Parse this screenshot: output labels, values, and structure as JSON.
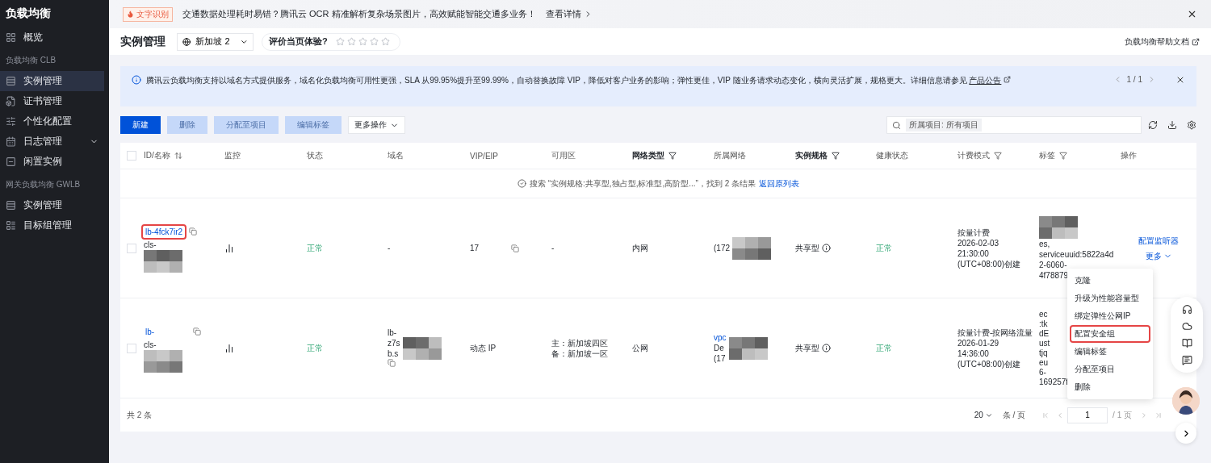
{
  "sidebar": {
    "title": "负载均衡",
    "items": [
      {
        "kind": "item",
        "label": "概览",
        "selected": false
      },
      {
        "kind": "group",
        "label": "负载均衡 CLB"
      },
      {
        "kind": "item",
        "label": "实例管理",
        "selected": true
      },
      {
        "kind": "item",
        "label": "证书管理",
        "selected": false
      },
      {
        "kind": "item",
        "label": "个性化配置",
        "selected": false
      },
      {
        "kind": "item",
        "label": "日志管理",
        "selected": false,
        "expanded": false
      },
      {
        "kind": "item",
        "label": "闲置实例",
        "selected": false
      },
      {
        "kind": "group",
        "label": "网关负载均衡 GWLB"
      },
      {
        "kind": "item",
        "label": "实例管理",
        "selected": false
      },
      {
        "kind": "item",
        "label": "目标组管理",
        "selected": false
      }
    ]
  },
  "banner": {
    "tag": "文字识别",
    "text": "交通数据处理耗时易错？腾讯云 OCR 精准解析复杂场景图片，高效赋能智能交通多业务！",
    "link": "查看详情"
  },
  "header": {
    "title": "实例管理",
    "region": "新加坡 2",
    "rating_label": "评价当页体验?",
    "stars": 0,
    "doc_link": "负载均衡帮助文档"
  },
  "notice": {
    "text": "腾讯云负载均衡支持以域名方式提供服务，域名化负载均衡可用性更强，SLA 从99.95%提升至99.99%，自动替换故障 VIP，降低对客户业务的影响；弹性更佳，VIP 随业务请求动态变化，横向灵活扩展，规格更大。详细信息请参见",
    "link": "产品公告",
    "pager": "1 / 1"
  },
  "toolbar": {
    "buttons": [
      {
        "kind": "primary",
        "label": "新建",
        "disabled": false
      },
      {
        "kind": "primary",
        "label": "删除",
        "disabled": true
      },
      {
        "kind": "primary",
        "label": "分配至项目",
        "disabled": true
      },
      {
        "kind": "primary",
        "label": "编辑标签",
        "disabled": true
      },
      {
        "kind": "dropdown",
        "label": "更多操作"
      }
    ],
    "search_tag": "所属项目: 所有项目"
  },
  "table": {
    "all_checked": false,
    "columns": [
      {
        "label": "ID/名称",
        "sort": true,
        "filter": false,
        "filtered": false
      },
      {
        "label": "监控",
        "sort": false,
        "filter": false,
        "filtered": false
      },
      {
        "label": "状态",
        "sort": false,
        "filter": false,
        "filtered": false
      },
      {
        "label": "域名",
        "sort": false,
        "filter": false,
        "filtered": false
      },
      {
        "label": "VIP/EIP",
        "sort": false,
        "filter": false,
        "filtered": false
      },
      {
        "label": "可用区",
        "sort": false,
        "filter": false,
        "filtered": false
      },
      {
        "label": "网络类型",
        "sort": false,
        "filter": true,
        "filtered": true
      },
      {
        "label": "所属网络",
        "sort": false,
        "filter": false,
        "filtered": false
      },
      {
        "label": "实例规格",
        "sort": false,
        "filter": true,
        "filtered": true
      },
      {
        "label": "健康状态",
        "sort": false,
        "filter": false,
        "filtered": false
      },
      {
        "label": "计费模式",
        "sort": false,
        "filter": true,
        "filtered": false
      },
      {
        "label": "标签",
        "sort": false,
        "filter": true,
        "filtered": false
      },
      {
        "label": "操作",
        "sort": false,
        "filter": false,
        "filtered": false
      }
    ],
    "search_result": {
      "text": "搜索 “实例规格:共享型,独占型,标准型,高阶型...”，找到 2 条结果",
      "link": "返回原列表"
    },
    "rows": [
      {
        "checked": false,
        "id": "lb-4fck7ir2",
        "id_highlighted": true,
        "id_lines": [
          "cls-"
        ],
        "status": "正常",
        "domain": [
          "-"
        ],
        "domain_copy": false,
        "vip": "17",
        "vip_copy": true,
        "zone": [
          "-"
        ],
        "net_type": "内网",
        "vpc": [
          "(172"
        ],
        "vpc_link": false,
        "spec": "共享型",
        "health": "正常",
        "billing": [
          "按量计费",
          "2026-02-03",
          "21:30:00",
          "(UTC+08:00)创建"
        ],
        "tags": [
          "es,",
          "serviceuuid:5822a4d",
          "2-6060-",
          "4f78879"
        ],
        "actions": [
          "配置监听器",
          "更多"
        ]
      },
      {
        "checked": false,
        "id": "lb-",
        "id_highlighted": false,
        "id_lines": [
          "cls-"
        ],
        "status": "正常",
        "domain": [
          "lb-",
          "z7s",
          "b.s"
        ],
        "domain_copy": true,
        "vip": "动态 IP",
        "vip_copy": false,
        "zone": [
          "主：新加坡四区",
          "备：新加坡一区"
        ],
        "net_type": "公网",
        "vpc": [
          "vpc",
          "De",
          "(17"
        ],
        "vpc_link": true,
        "spec": "共享型",
        "health": "正常",
        "billing": [
          "按量计费-按网络流量",
          "2026-01-29",
          "14:36:00",
          "(UTC+08:00)创建"
        ],
        "tags": [
          "ec",
          ":tk",
          "dE",
          "ust",
          "tjq",
          "eu",
          "6-",
          "169257f"
        ],
        "actions": []
      }
    ],
    "menu": [
      {
        "label": "克隆",
        "selected": false
      },
      {
        "label": "升级为性能容量型",
        "selected": false
      },
      {
        "label": "绑定弹性公网IP",
        "selected": false
      },
      {
        "label": "配置安全组",
        "selected": true
      },
      {
        "label": "编辑标签",
        "selected": false
      },
      {
        "label": "分配至项目",
        "selected": false
      },
      {
        "label": "删除",
        "selected": false
      }
    ]
  },
  "footer": {
    "total": "共 2 条",
    "page_size": "20",
    "page_size_unit": "条 / 页",
    "page": "1",
    "pages": "/ 1 页"
  }
}
